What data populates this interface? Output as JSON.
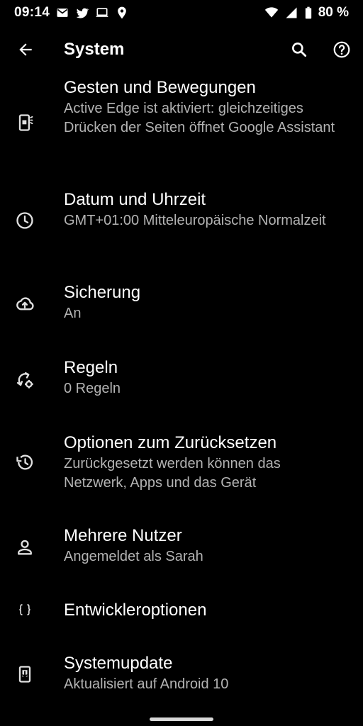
{
  "status_bar": {
    "time": "09:14",
    "battery": "80 %",
    "left_icons": [
      "gmail-icon",
      "twitter-icon",
      "laptop-icon",
      "location-icon"
    ],
    "right_icons": [
      "wifi-icon",
      "cell-signal-icon",
      "battery-icon"
    ]
  },
  "app_bar": {
    "title": "System"
  },
  "settings": [
    {
      "id": "gestures",
      "icon": "phone-gesture-icon",
      "title": "Gesten und Bewegungen",
      "summary": "Active Edge ist aktiviert: gleichzeitiges Drücken der Seiten öffnet Google Assistant"
    },
    {
      "id": "datetime",
      "icon": "clock-icon",
      "title": "Datum und Uhrzeit",
      "summary": "GMT+01:00 Mitteleuropäische Normalzeit"
    },
    {
      "id": "backup",
      "icon": "cloud-upload-icon",
      "title": "Sicherung",
      "summary": "An"
    },
    {
      "id": "rules",
      "icon": "rules-icon",
      "title": "Regeln",
      "summary": "0 Regeln"
    },
    {
      "id": "reset",
      "icon": "history-icon",
      "title": "Optionen zum Zurücksetzen",
      "summary": "Zurückgesetzt werden können das Netzwerk, Apps und das Gerät"
    },
    {
      "id": "users",
      "icon": "person-icon",
      "title": "Mehrere Nutzer",
      "summary": "Angemeldet als Sarah"
    },
    {
      "id": "developer",
      "icon": "braces-icon",
      "title": "Entwickleroptionen",
      "summary": ""
    },
    {
      "id": "update",
      "icon": "system-update-icon",
      "title": "Systemupdate",
      "summary": "Aktualisiert auf Android 10"
    }
  ],
  "colors": {
    "background": "#000000",
    "title_text": "#ffffff",
    "summary_text": "#b3b3b3",
    "icon": "#e0e0e0"
  }
}
